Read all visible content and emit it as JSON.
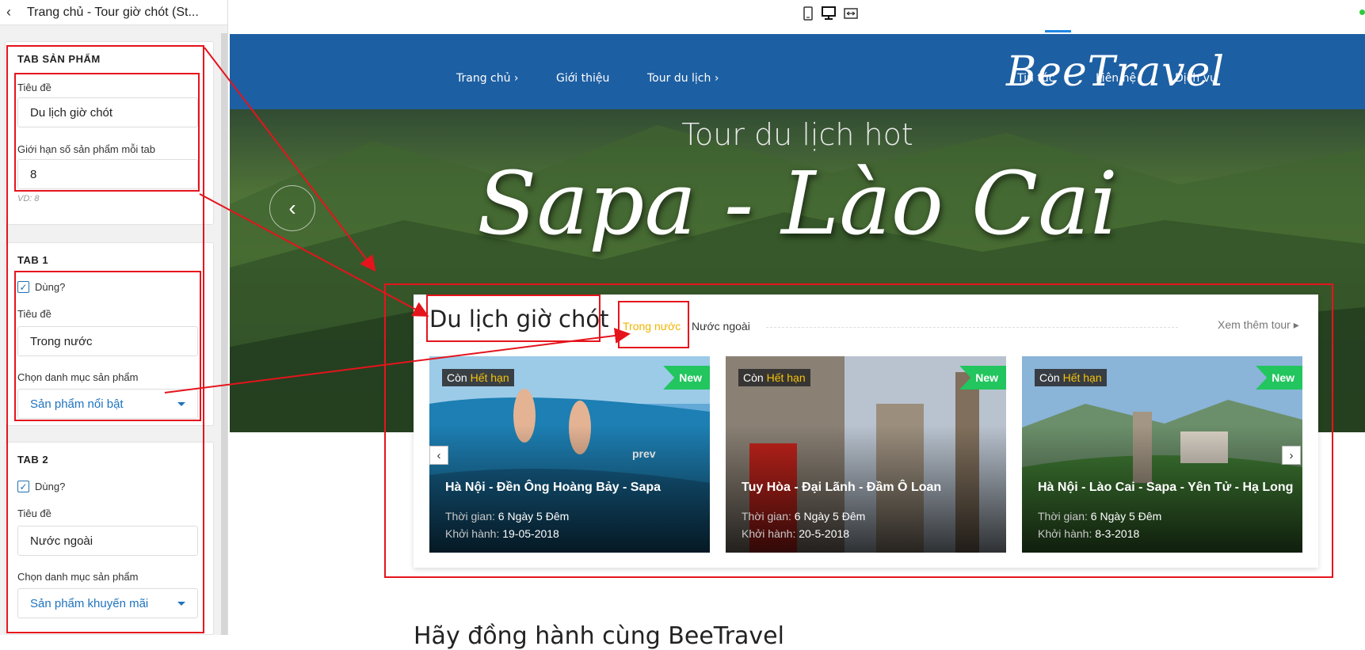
{
  "panel": {
    "title": "Trang chủ - Tour giờ chót (St...",
    "section_main": {
      "title": "TAB SẢN PHẨM",
      "title_label": "Tiêu đề",
      "title_value": "Du lịch giờ chót",
      "limit_label": "Giới hạn số sản phẩm mỗi tab",
      "limit_value": "8",
      "limit_hint": "VD: 8"
    },
    "tab1": {
      "title": "TAB 1",
      "use_label": "Dùng?",
      "use_checked": true,
      "title_label": "Tiêu đề",
      "title_value": "Trong nước",
      "category_label": "Chọn danh mục sản phẩm",
      "category_value": "Sản phẩm nổi bật"
    },
    "tab2": {
      "title": "TAB 2",
      "use_label": "Dùng?",
      "use_checked": true,
      "title_label": "Tiêu đề",
      "title_value": "Nước ngoài",
      "category_label": "Chọn danh mục sản phẩm",
      "category_value": "Sản phẩm khuyến mãi"
    }
  },
  "device_bar": {
    "icons": [
      "mobile-icon",
      "desktop-icon",
      "fullwidth-icon"
    ],
    "active": "desktop-icon"
  },
  "site": {
    "nav": {
      "items": [
        "Trang chủ ›",
        "Giới thiệu",
        "Tour du lịch ›",
        "Tin tức",
        "Liên hệ",
        "Dịch vụ"
      ],
      "logo": "BeeTravel"
    },
    "hero": {
      "subtitle": "Tour du lịch hot",
      "title": "Sapa - Lào Cai",
      "prev_arrow": "‹"
    },
    "tours": {
      "title": "Du lịch giờ chót",
      "tabs": [
        "Trong nước",
        "Nước ngoài"
      ],
      "active_tab": "Trong nước",
      "view_more": "Xem thêm tour ▸",
      "cards": [
        {
          "badge_prefix": "Còn",
          "badge_status": "Hết hạn",
          "new": "New",
          "title": "Hà Nội - Đền Ông Hoàng Bảy - Sapa",
          "duration_label": "Thời gian:",
          "duration": "6 Ngày 5 Đêm",
          "depart_label": "Khởi hành:",
          "depart": "19-05-2018",
          "overlay": "prev"
        },
        {
          "badge_prefix": "Còn",
          "badge_status": "Hết hạn",
          "new": "New",
          "title": "Tuy Hòa - Đại Lãnh - Đầm Ô Loan",
          "duration_label": "Thời gian:",
          "duration": "6 Ngày 5 Đêm",
          "depart_label": "Khởi hành:",
          "depart": "20-5-2018"
        },
        {
          "badge_prefix": "Còn",
          "badge_status": "Hết hạn",
          "new": "New",
          "title": "Hà Nội - Lào Cai - Sapa - Yên Tử - Hạ Long",
          "duration_label": "Thời gian:",
          "duration": "6 Ngày 5 Đêm",
          "depart_label": "Khởi hành:",
          "depart": "8-3-2018"
        }
      ],
      "slider_prev": "‹",
      "slider_next": "›"
    },
    "footer_heading": "Hãy đồng hành cùng BeeTravel"
  },
  "colors": {
    "nav_bg": "#1d5fa3",
    "accent_yellow": "#f0b400",
    "new_badge": "#22c55e",
    "annotation_red": "#e5141c",
    "link_blue": "#1e73be"
  }
}
